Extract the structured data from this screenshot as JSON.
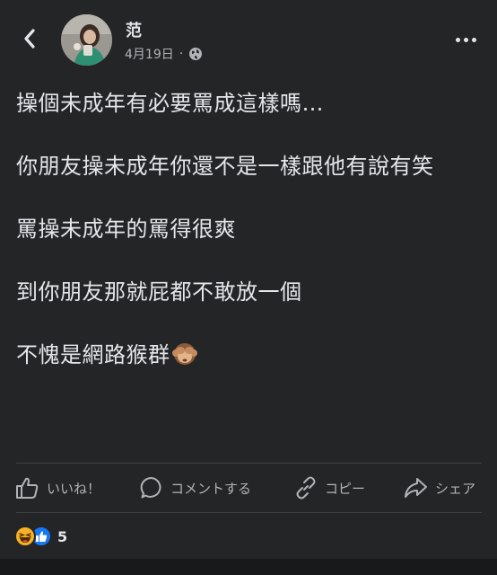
{
  "header": {
    "author_name": "范",
    "date": "4月19日",
    "separator": "·",
    "privacy_icon": "globe-icon"
  },
  "post": {
    "paragraphs": [
      "操個未成年有必要罵成這樣嗎…",
      "你朋友操未成年你還不是一樣跟他有說有笑",
      "罵操未成年的罵得很爽",
      "到你朋友那就屁都不敢放一個",
      "不愧是網路猴群"
    ],
    "trailing_emoji": "see-no-evil-monkey"
  },
  "actions": {
    "like": "いいね！",
    "comment": "コメントする",
    "copy": "コピー",
    "share": "シェア"
  },
  "reactions": {
    "types": [
      "haha",
      "like"
    ],
    "count": "5"
  },
  "colors": {
    "background": "#242526",
    "text": "#e4e6eb",
    "secondary_text": "#b0b3b8",
    "like_blue": "#1877f2",
    "haha_yellow": "#f7b125"
  }
}
